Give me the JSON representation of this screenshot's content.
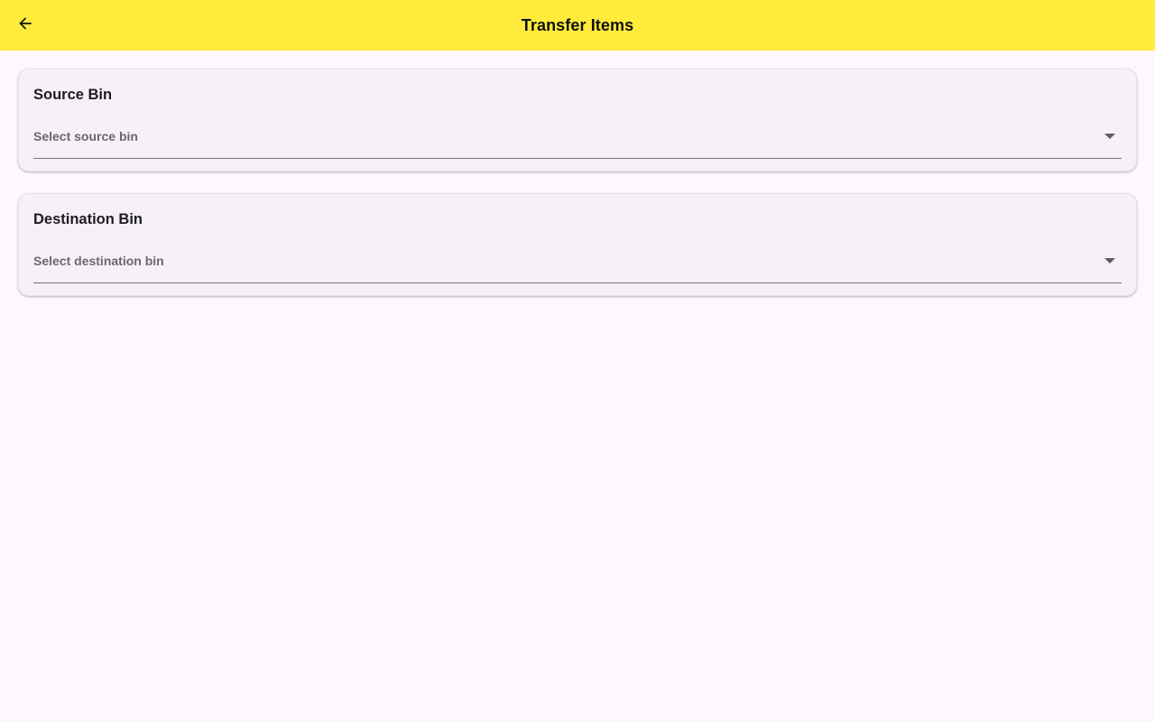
{
  "app_bar": {
    "title": "Transfer Items",
    "back_icon": "arrow-left-icon",
    "background": "#ffeb3b"
  },
  "source_card": {
    "title": "Source Bin",
    "dropdown": {
      "placeholder": "Select source bin",
      "icon": "caret-down-icon"
    }
  },
  "destination_card": {
    "title": "Destination Bin",
    "dropdown": {
      "placeholder": "Select destination bin",
      "icon": "caret-down-icon"
    }
  }
}
